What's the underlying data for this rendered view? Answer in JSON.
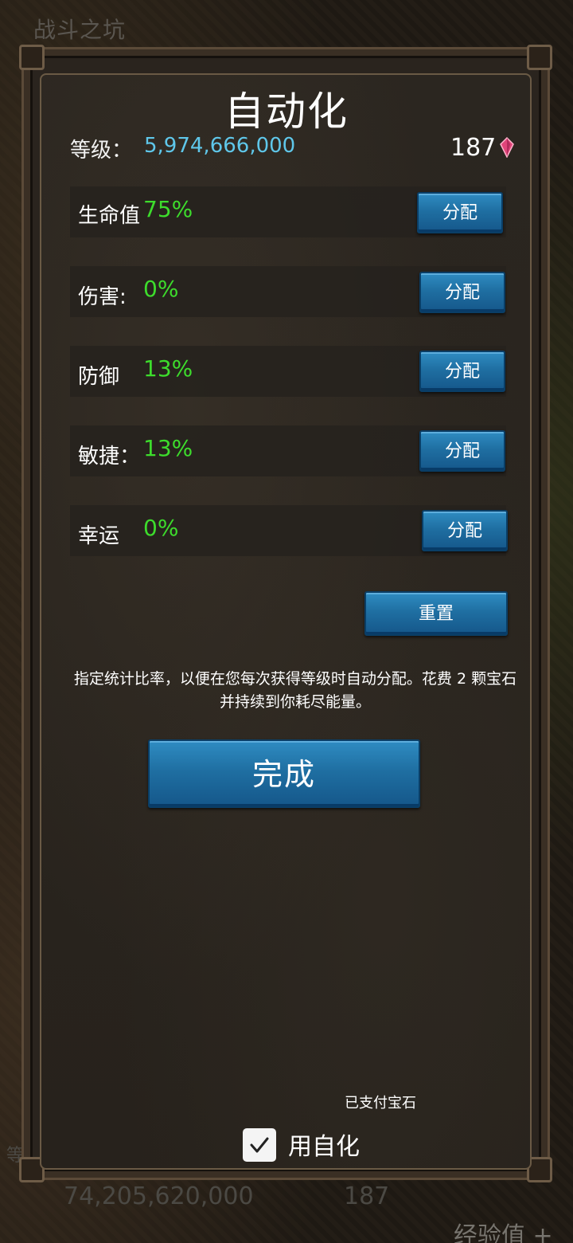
{
  "background": {
    "screen_title": "战斗之坑",
    "level_value": "74,205,620,000",
    "gem_count": "187",
    "exp_label": "经验值 +",
    "side_label": "等"
  },
  "dialog": {
    "title": "自动化",
    "level_label": "等级：",
    "level_value": "5,974,666,000",
    "gem_count": "187",
    "gem_icon": "pink-gem-icon",
    "stats": [
      {
        "label": "生命值",
        "value": "75%",
        "button": "分配"
      },
      {
        "label": "伤害:",
        "value": "0%",
        "button": "分配"
      },
      {
        "label": "防御",
        "value": "13%",
        "button": "分配"
      },
      {
        "label": "敏捷：",
        "value": "13%",
        "button": "分配"
      },
      {
        "label": "幸运",
        "value": "0%",
        "button": "分配"
      }
    ],
    "reset_label": "重置",
    "description": "指定统计比率，以便在您每次获得等级时自动分配。花费 2 颗宝石并持续到你耗尽能量。",
    "done_label": "完成",
    "paid_label": "已支付宝石",
    "automation_checkbox": {
      "label": "用自化",
      "checked": true
    }
  },
  "colors": {
    "stat_value": "#3ddc2c",
    "level_value": "#5fc7ea",
    "button": "#1f6fa2"
  }
}
